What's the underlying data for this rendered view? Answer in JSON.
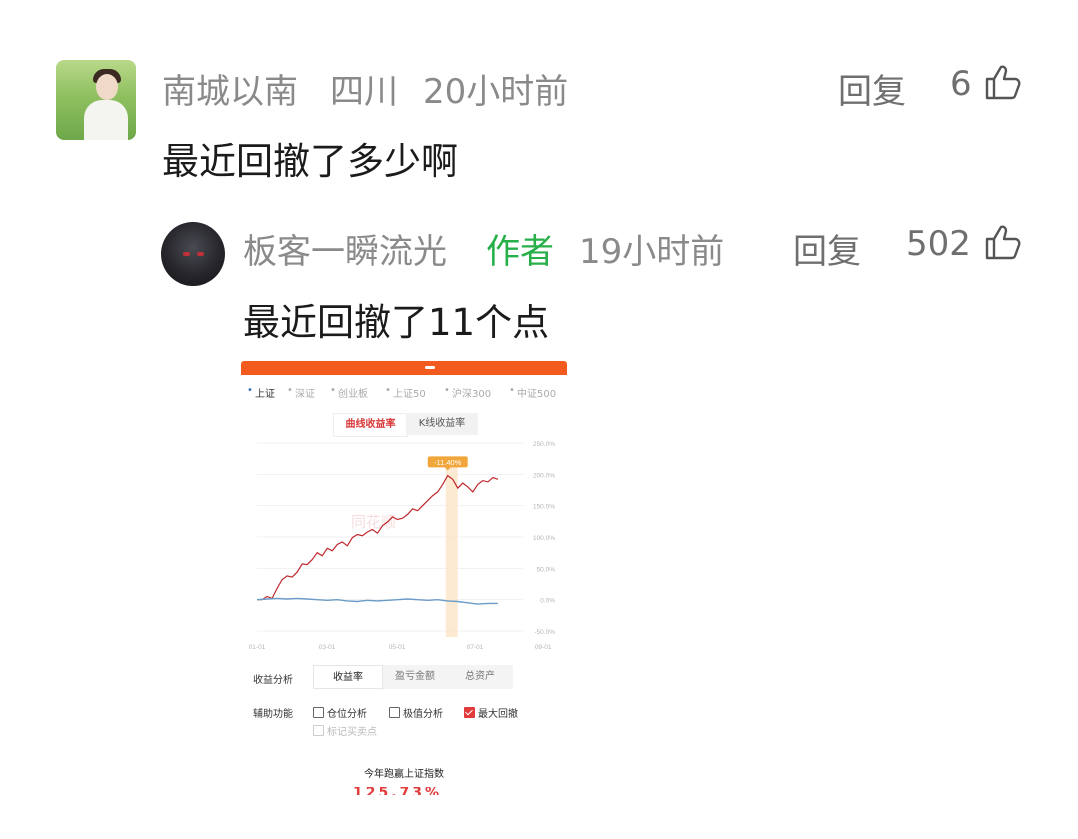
{
  "comment": {
    "user": "南城以南",
    "location": "四川",
    "time": "20小时前",
    "reply_label": "回复",
    "likes": "6",
    "text": "最近回撤了多少啊"
  },
  "reply": {
    "user": "板客一瞬流光",
    "author_tag": "作者",
    "time": "19小时前",
    "reply_label": "回复",
    "likes": "502",
    "text": "最近回撤了11个点"
  },
  "embedded": {
    "indices": [
      "上证",
      "深证",
      "创业板",
      "上证50",
      "沪深300",
      "中证500"
    ],
    "selected_index": "上证",
    "segment_tabs": [
      "曲线收益率",
      "K线收益率"
    ],
    "watermark": "同花顺",
    "income_analysis_label": "收益分析",
    "income_tabs": [
      "收益率",
      "盈亏金额",
      "总资产"
    ],
    "aux_label": "辅助功能",
    "aux_options": [
      {
        "label": "仓位分析",
        "checked": false
      },
      {
        "label": "极值分析",
        "checked": false
      },
      {
        "label": "最大回撤",
        "checked": true
      }
    ],
    "mark_trades_label": "标记买卖点",
    "bottom_title": "今年跑赢上证指数",
    "bottom_value_partial": "125.73%"
  },
  "chart_data": {
    "type": "line",
    "x_ticks": [
      "01-01",
      "03-01",
      "05-01",
      "07-01",
      "09-01"
    ],
    "y_ticks": [
      "250.0%",
      "200.0%",
      "150.0%",
      "100.0%",
      "50.0%",
      "0.0%",
      "-50.0%"
    ],
    "ylim": [
      -50,
      250
    ],
    "grid": true,
    "drawdown_annotation": "-11.40%",
    "series": [
      {
        "color": "#c0282d",
        "x": [
          0,
          5,
          10,
          15,
          20,
          25,
          30,
          35,
          40,
          45,
          50,
          55,
          60,
          65,
          70,
          75,
          80,
          85,
          90,
          95,
          100,
          105,
          110,
          115,
          120,
          125,
          130,
          135,
          140,
          145,
          150,
          155,
          160,
          165,
          170,
          175,
          180,
          185,
          190,
          195,
          200,
          205,
          210,
          215,
          220,
          225,
          230,
          235,
          240
        ],
        "values": [
          0,
          0,
          5,
          2,
          18,
          32,
          38,
          36,
          44,
          57,
          56,
          64,
          75,
          70,
          82,
          78,
          88,
          92,
          86,
          99,
          104,
          102,
          108,
          112,
          106,
          118,
          124,
          132,
          128,
          130,
          136,
          145,
          142,
          150,
          158,
          166,
          172,
          184,
          198,
          192,
          178,
          186,
          180,
          172,
          184,
          190,
          188,
          195,
          192
        ]
      },
      {
        "color": "#6b9bc9",
        "x": [
          0,
          10,
          20,
          30,
          40,
          50,
          60,
          70,
          80,
          90,
          100,
          110,
          120,
          130,
          140,
          150,
          160,
          170,
          180,
          190,
          200,
          210,
          220,
          230,
          240
        ],
        "values": [
          0,
          1,
          2,
          1,
          2,
          1,
          0,
          -1,
          0,
          -2,
          -3,
          -1,
          -2,
          -1,
          0,
          1,
          0,
          -1,
          0,
          -2,
          -3,
          -5,
          -7,
          -6,
          -6
        ]
      }
    ],
    "drawdown_span": [
      190,
      200
    ]
  }
}
